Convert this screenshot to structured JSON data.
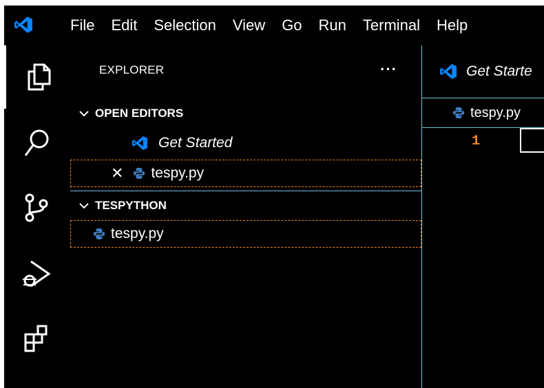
{
  "menubar": {
    "items": [
      "File",
      "Edit",
      "Selection",
      "View",
      "Go",
      "Run",
      "Terminal",
      "Help"
    ]
  },
  "activity_bar": {
    "items": [
      "explorer-icon",
      "search-icon",
      "source-control-icon",
      "run-debug-icon",
      "extensions-icon"
    ]
  },
  "sidebar": {
    "title": "EXPLORER",
    "more": "···",
    "open_editors": {
      "header": "OPEN EDITORS",
      "items": [
        {
          "label": "Get Started",
          "icon": "vscode-logo-icon"
        },
        {
          "label": "tespy.py",
          "icon": "python-icon",
          "close": "✕"
        }
      ]
    },
    "folder": {
      "header": "TESPYTHON",
      "files": [
        {
          "label": "tespy.py",
          "icon": "python-icon"
        }
      ]
    }
  },
  "editor": {
    "tab_label": "Get Starte",
    "breadcrumb_file": "tespy.py",
    "line_number": "1"
  },
  "colors": {
    "background": "#000000",
    "border_accent": "#6fc3df",
    "focus_outline": "#f38518",
    "vscode_blue": "#0a84ff",
    "python_blue": "#3f7dc0",
    "line_number": "#f38518"
  }
}
